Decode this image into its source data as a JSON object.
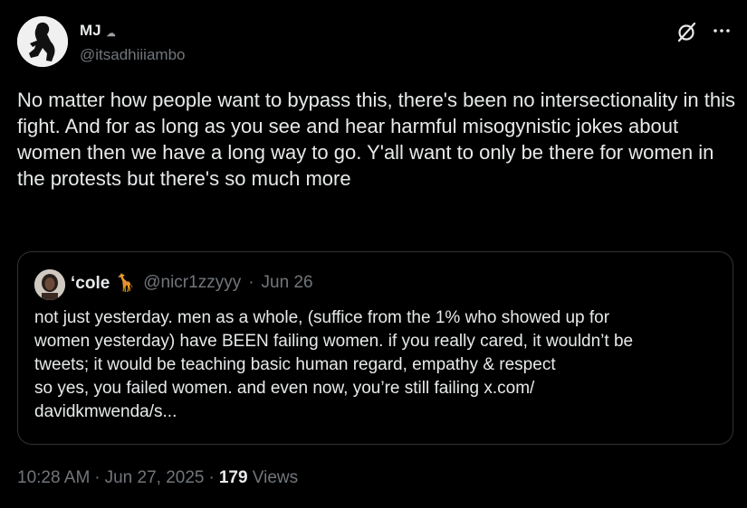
{
  "author": {
    "name": "MJ",
    "name_emoji": "☁",
    "handle": "@itsadhiiiambo"
  },
  "tweet": {
    "text": "No matter how people want to bypass this, there's been no intersectionality in this fight. And for as long as you see and hear harmful misogynistic jokes about women then we have a long way to go. Y'all want to only be there for women in the protests but there's so much more"
  },
  "quoted": {
    "name": "‘cole 🦒",
    "handle": "@nicr1zzyyy",
    "separator": "·",
    "date": "Jun 26",
    "lines": [
      "not just yesterday. men as a whole, (suffice from the 1% who showed up for",
      "women yesterday) have BEEN failing women. if you really cared, it wouldn’t be",
      "tweets; it would be teaching basic human regard, empathy & respect",
      "so yes, you failed women. and even now, you’re still failing x.com/",
      "davidkmwenda/s..."
    ]
  },
  "meta": {
    "time": "10:28 AM",
    "separator": "·",
    "date": "Jun 27, 2025",
    "separator2": "·",
    "views_count": "179",
    "views_label": "Views"
  },
  "icons": {
    "grok": "grok-icon",
    "more": "more-icon"
  },
  "colors": {
    "background": "#000000",
    "primary_text": "#e7e9ea",
    "secondary_text": "#71767b",
    "border": "#2f3336"
  }
}
